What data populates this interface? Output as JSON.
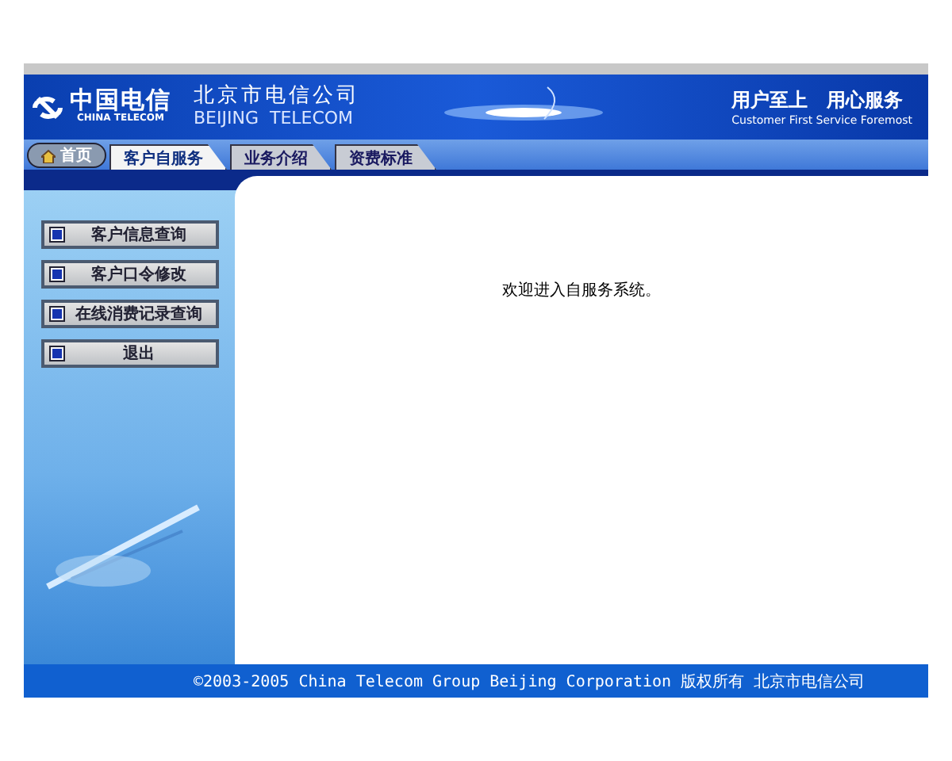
{
  "header": {
    "logo_cn": "中国电信",
    "logo_en": "CHINA TELECOM",
    "company_cn": "北京市电信公司",
    "company_en": "BEIJING  TELECOM",
    "slogan_cn": "用户至上　用心服务",
    "slogan_en": "Customer First Service Foremost"
  },
  "tabs": [
    {
      "label": "首页",
      "kind": "home",
      "selected": false
    },
    {
      "label": "客户自服务",
      "kind": "tab",
      "selected": true
    },
    {
      "label": "业务介绍",
      "kind": "tab",
      "selected": false
    },
    {
      "label": "资费标准",
      "kind": "tab",
      "selected": false
    }
  ],
  "sidebar": {
    "items": [
      {
        "label": "客户信息查询"
      },
      {
        "label": "客户口令修改"
      },
      {
        "label": "在线消费记录查询"
      },
      {
        "label": "退出"
      }
    ]
  },
  "content": {
    "message": "欢迎进入自服务系统。"
  },
  "footer": "©2003-2005 China Telecom Group Beijing Corporation 版权所有 北京市电信公司"
}
